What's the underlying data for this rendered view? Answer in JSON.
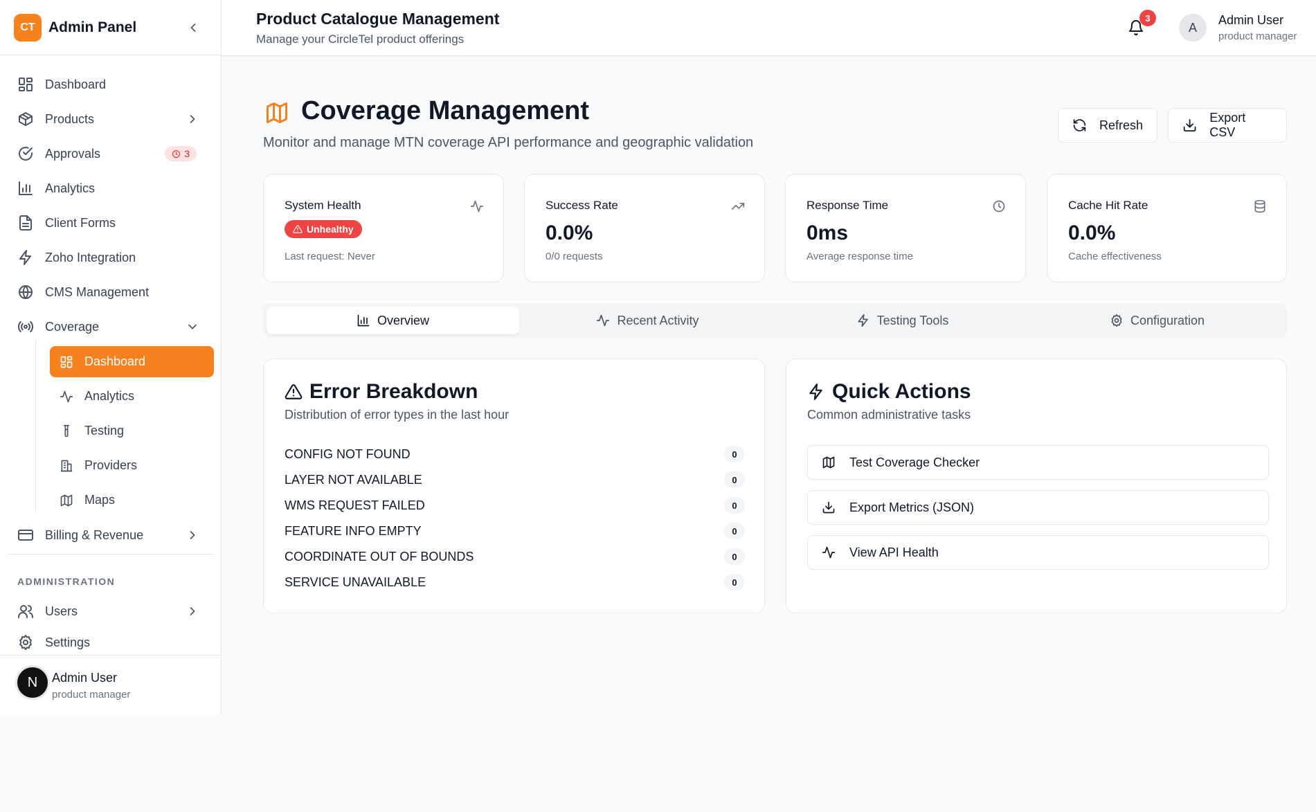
{
  "sidebar": {
    "logo_text": "CT",
    "brand": "Admin Panel",
    "items": [
      {
        "label": "Dashboard"
      },
      {
        "label": "Products"
      },
      {
        "label": "Approvals",
        "badge": "3"
      },
      {
        "label": "Analytics"
      },
      {
        "label": "Client Forms"
      },
      {
        "label": "Zoho Integration"
      },
      {
        "label": "CMS Management"
      },
      {
        "label": "Coverage"
      },
      {
        "label": "Billing & Revenue"
      }
    ],
    "coverage_sub": [
      {
        "label": "Dashboard"
      },
      {
        "label": "Analytics"
      },
      {
        "label": "Testing"
      },
      {
        "label": "Providers"
      },
      {
        "label": "Maps"
      }
    ],
    "section_admin": "ADMINISTRATION",
    "admin_items": [
      {
        "label": "Users"
      },
      {
        "label": "Settings"
      }
    ],
    "footer": {
      "avatar": "N",
      "name": "Admin User",
      "role": "product manager"
    }
  },
  "topbar": {
    "title": "Product Catalogue Management",
    "subtitle": "Manage your CircleTel product offerings",
    "notifications": "3",
    "avatar": "A",
    "user_name": "Admin User",
    "user_role": "product manager"
  },
  "page": {
    "title": "Coverage Management",
    "subtitle": "Monitor and manage MTN coverage API performance and geographic validation",
    "refresh_label": "Refresh",
    "export_label": "Export CSV"
  },
  "stats": {
    "health": {
      "label": "System Health",
      "status": "Unhealthy",
      "note": "Last request: Never"
    },
    "success": {
      "label": "Success Rate",
      "value": "0.0%",
      "note": "0/0 requests"
    },
    "response": {
      "label": "Response Time",
      "value": "0ms",
      "note": "Average response time"
    },
    "cache": {
      "label": "Cache Hit Rate",
      "value": "0.0%",
      "note": "Cache effectiveness"
    }
  },
  "tabs": [
    {
      "label": "Overview"
    },
    {
      "label": "Recent Activity"
    },
    {
      "label": "Testing Tools"
    },
    {
      "label": "Configuration"
    }
  ],
  "errors": {
    "title": "Error Breakdown",
    "subtitle": "Distribution of error types in the last hour",
    "rows": [
      {
        "label": "CONFIG NOT FOUND",
        "count": "0"
      },
      {
        "label": "LAYER NOT AVAILABLE",
        "count": "0"
      },
      {
        "label": "WMS REQUEST FAILED",
        "count": "0"
      },
      {
        "label": "FEATURE INFO EMPTY",
        "count": "0"
      },
      {
        "label": "COORDINATE OUT OF BOUNDS",
        "count": "0"
      },
      {
        "label": "SERVICE UNAVAILABLE",
        "count": "0"
      }
    ]
  },
  "quick_actions": {
    "title": "Quick Actions",
    "subtitle": "Common administrative tasks",
    "items": [
      {
        "label": "Test Coverage Checker"
      },
      {
        "label": "Export Metrics (JSON)"
      },
      {
        "label": "View API Health"
      }
    ]
  },
  "colors": {
    "accent": "#f5821f",
    "danger": "#ef4444"
  }
}
